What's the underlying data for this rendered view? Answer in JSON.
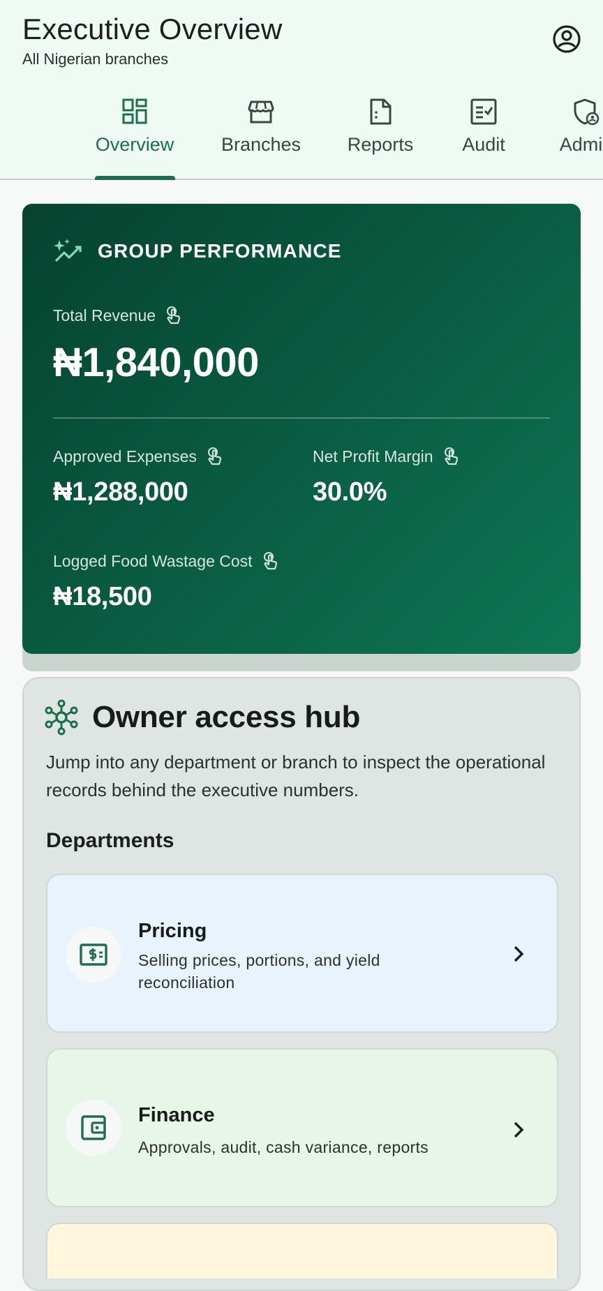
{
  "header": {
    "title": "Executive Overview",
    "subtitle": "All Nigerian branches",
    "account_icon": "account-circle-icon"
  },
  "tabs": [
    {
      "label": "Overview",
      "icon": "dashboard-icon",
      "active": true
    },
    {
      "label": "Branches",
      "icon": "storefront-icon",
      "active": false
    },
    {
      "label": "Reports",
      "icon": "document-icon",
      "active": false
    },
    {
      "label": "Audit",
      "icon": "checklist-icon",
      "active": false
    },
    {
      "label": "Admin",
      "icon": "admin-shield-icon",
      "active": false
    }
  ],
  "performance": {
    "heading": "GROUP PERFORMANCE",
    "total_revenue": {
      "label": "Total Revenue",
      "value": "₦1,840,000"
    },
    "approved_expenses": {
      "label": "Approved Expenses",
      "value": "₦1,288,000"
    },
    "net_profit_margin": {
      "label": "Net Profit Margin",
      "value": "30.0%"
    },
    "food_wastage": {
      "label": "Logged Food Wastage Cost",
      "value": "₦18,500"
    }
  },
  "hub": {
    "title": "Owner access hub",
    "description": "Jump into any department or branch to inspect the operational records behind the executive numbers.",
    "departments_title": "Departments",
    "departments": [
      {
        "title": "Pricing",
        "description": "Selling prices, portions, and yield reconciliation",
        "icon": "pricing-icon",
        "color": "#e8f3fd"
      },
      {
        "title": "Finance",
        "description": "Approvals, audit, cash variance, reports",
        "icon": "wallet-icon",
        "color": "#e8f5e9"
      },
      {
        "title": "",
        "description": "",
        "icon": "",
        "color": "#fff6dd"
      }
    ]
  },
  "colors": {
    "brand": "#1c6e4e",
    "card_dark": "#06422f",
    "card_light": "#0e7654"
  }
}
